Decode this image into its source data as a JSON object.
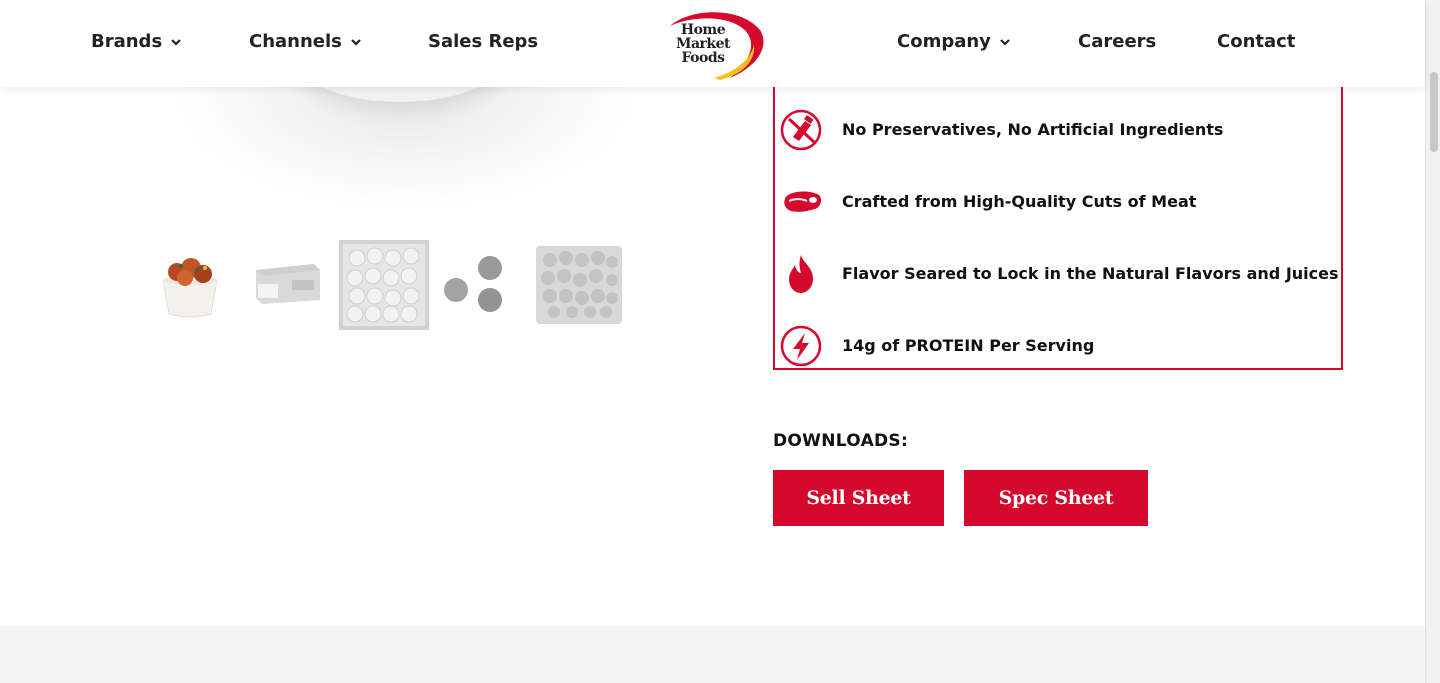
{
  "nav": {
    "left": [
      {
        "label": "Brands",
        "dropdown": true
      },
      {
        "label": "Channels",
        "dropdown": true
      },
      {
        "label": "Sales Reps",
        "dropdown": false
      }
    ],
    "right": [
      {
        "label": "Company",
        "dropdown": true
      },
      {
        "label": "Careers",
        "dropdown": false
      },
      {
        "label": "Contact",
        "dropdown": false
      }
    ],
    "logo": {
      "line1": "Home",
      "line2": "Market",
      "line3": "Foods"
    }
  },
  "thumbnails": [
    {
      "icon": "meatballs-bowl-thumbnail"
    },
    {
      "icon": "product-box-thumbnail"
    },
    {
      "icon": "case-contents-thumbnail"
    },
    {
      "icon": "three-meatballs-thumbnail"
    },
    {
      "icon": "bagged-meatballs-thumbnail"
    }
  ],
  "features": [
    {
      "icon": "no-preservatives-icon",
      "text": "No Preservatives, No Artificial Ingredients"
    },
    {
      "icon": "steak-icon",
      "text": "Crafted from High-Quality Cuts of Meat"
    },
    {
      "icon": "flame-icon",
      "text": "Flavor Seared to Lock in the Natural Flavors and Juices"
    },
    {
      "icon": "lightning-icon",
      "text": "14g of PROTEIN Per Serving"
    }
  ],
  "downloads": {
    "label": "DOWNLOADS:",
    "sell_sheet": "Sell Sheet",
    "spec_sheet": "Spec Sheet"
  },
  "colors": {
    "accent": "#d4092d",
    "logo_yellow": "#f3c019"
  }
}
